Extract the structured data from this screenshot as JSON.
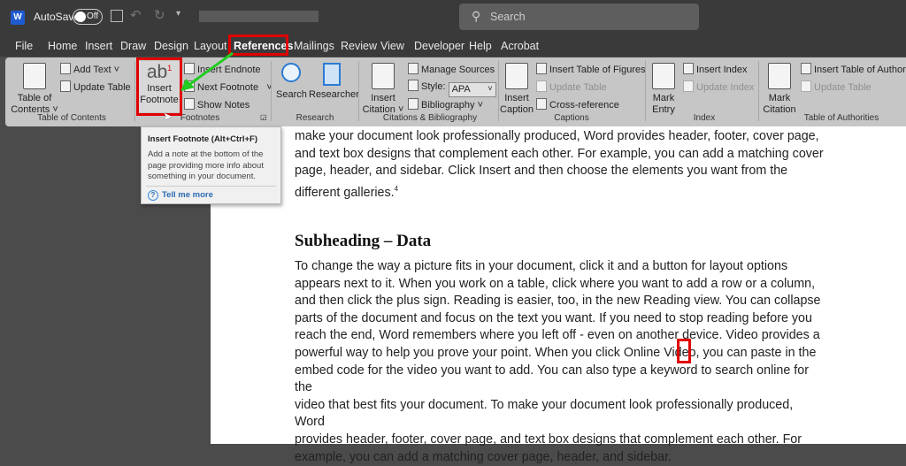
{
  "titlebar": {
    "autosave": "AutoSave",
    "toggle": "Off",
    "search_placeholder": "Search"
  },
  "menu": [
    "File",
    "Home",
    "Insert",
    "Draw",
    "Design",
    "Layout",
    "References",
    "Mailings",
    "Review",
    "View",
    "Developer",
    "Help",
    "Acrobat"
  ],
  "ribbon": {
    "toc": {
      "big": "Table of Contents",
      "add_text": "Add Text",
      "update_table": "Update Table",
      "group": "Table of Contents"
    },
    "footnotes": {
      "big_icon": "ab",
      "big_sup": "1",
      "big": "Insert Footnote",
      "insert_endnote": "Insert Endnote",
      "next_footnote": "Next Footnote",
      "show_notes": "Show Notes",
      "group": "Footnotes"
    },
    "research": {
      "search": "Search",
      "researcher": "Researcher",
      "group": "Research"
    },
    "citations": {
      "big": "Insert Citation",
      "manage": "Manage Sources",
      "style_label": "Style:",
      "style_value": "APA",
      "bibliography": "Bibliography",
      "group": "Citations & Bibliography"
    },
    "captions": {
      "big": "Insert Caption",
      "tof": "Insert Table of Figures",
      "update": "Update Table",
      "cross": "Cross-reference",
      "group": "Captions"
    },
    "index": {
      "big": "Mark Entry",
      "insert": "Insert Index",
      "update": "Update Index",
      "group": "Index"
    },
    "toa": {
      "big": "Mark Citation",
      "insert": "Insert Table of Authorities",
      "update": "Update Table",
      "group": "Table of Authorities"
    }
  },
  "tooltip": {
    "title": "Insert Footnote (Alt+Ctrl+F)",
    "body": "Add a note at the bottom of the page providing more info about something in your document.",
    "link": "Tell me more"
  },
  "document": {
    "para1": [
      "make your document look professionally produced, Word provides header, footer, cover page,",
      "and text box designs that complement each other. For example, you can add a matching cover",
      "page, header, and sidebar. Click Insert and then choose the elements you want from the",
      "different galleries."
    ],
    "para1_sup": "4",
    "heading": "Subheading – Data",
    "para2": [
      "To change the way a picture fits in your document, click it and a button for layout options",
      "appears next to it. When you work on a table, click where you want to add a row or a column,",
      "and then click the plus sign. Reading is easier, too, in the new Reading view. You can collapse",
      "parts of the document and focus on the text you want. If you need to stop reading before you",
      "reach the end, Word remembers where you left off - even on another device. Video provides a",
      "powerful way to help you prove your point. When you click Online Video, you can paste in the",
      "embed code for the video you want to add. You can also type a keyword to search online for the",
      "video that best fits your document. To make your document look professionally produced, Word",
      "provides header, footer, cover page, and text box designs that complement each other. For",
      "example, you can add a matching cover page, header, and sidebar."
    ]
  },
  "colors": {
    "highlight": "#e00000",
    "arrow": "#22cc22",
    "link": "#2b6cb0"
  }
}
